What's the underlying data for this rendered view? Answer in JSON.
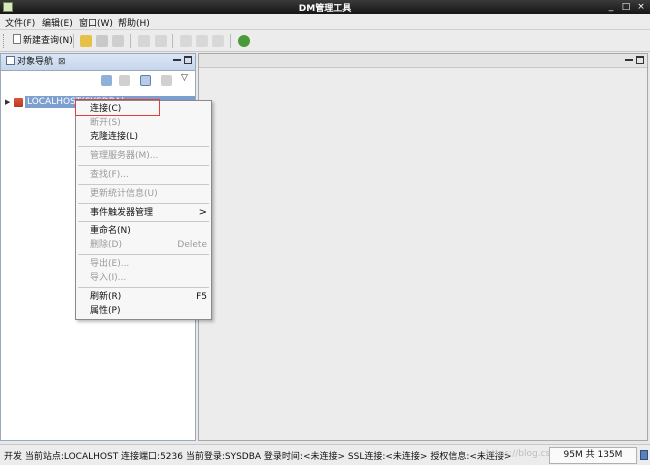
{
  "window": {
    "title": "DM管理工具",
    "controls": {
      "minimize": "_",
      "maximize": "□",
      "close": "×"
    }
  },
  "menubar": {
    "items": [
      "文件(F)",
      "编辑(E)",
      "窗口(W)",
      "帮助(H)"
    ]
  },
  "toolbar": {
    "new_query_label": "新建查询(N)"
  },
  "object_nav": {
    "tab_label": "对象导航",
    "close_glyph": "⊠",
    "view_menu_glyph": "▽",
    "tree_node": "LOCALHOST(SYSDBA)"
  },
  "context_menu": {
    "items": [
      {
        "label": "连接(C)",
        "enabled": true
      },
      {
        "label": "断开(S)",
        "enabled": false
      },
      {
        "label": "克隆连接(L)",
        "enabled": true
      },
      {
        "label": "管理服务器(M)...",
        "enabled": false
      },
      {
        "label": "查找(F)...",
        "enabled": false
      },
      {
        "label": "更新统计信息(U)",
        "enabled": false
      },
      {
        "label": "事件触发器管理",
        "enabled": true,
        "submenu": ">"
      },
      {
        "label": "重命名(N)",
        "enabled": true
      },
      {
        "label": "删除(D)",
        "enabled": false,
        "shortcut": "Delete"
      },
      {
        "label": "导出(E)...",
        "enabled": false
      },
      {
        "label": "导入(I)...",
        "enabled": false
      },
      {
        "label": "刷新(R)",
        "enabled": true,
        "shortcut": "F5"
      },
      {
        "label": "属性(P)",
        "enabled": true
      }
    ]
  },
  "statusbar": {
    "text": "开发  当前站点:LOCALHOST   连接端口:5236   当前登录:SYSDBA   登录时间:<未连接>   SSL连接:<未连接>   授权信息:<未连接>",
    "watermark": "https://blog.csdn.net/...",
    "heap": "95M 共 135M"
  },
  "colors": {
    "selection": "#7d9fd0",
    "highlight_box": "#e0403a",
    "title_bg": "#1e1e1e",
    "pane_border": "#9aa9c0"
  }
}
